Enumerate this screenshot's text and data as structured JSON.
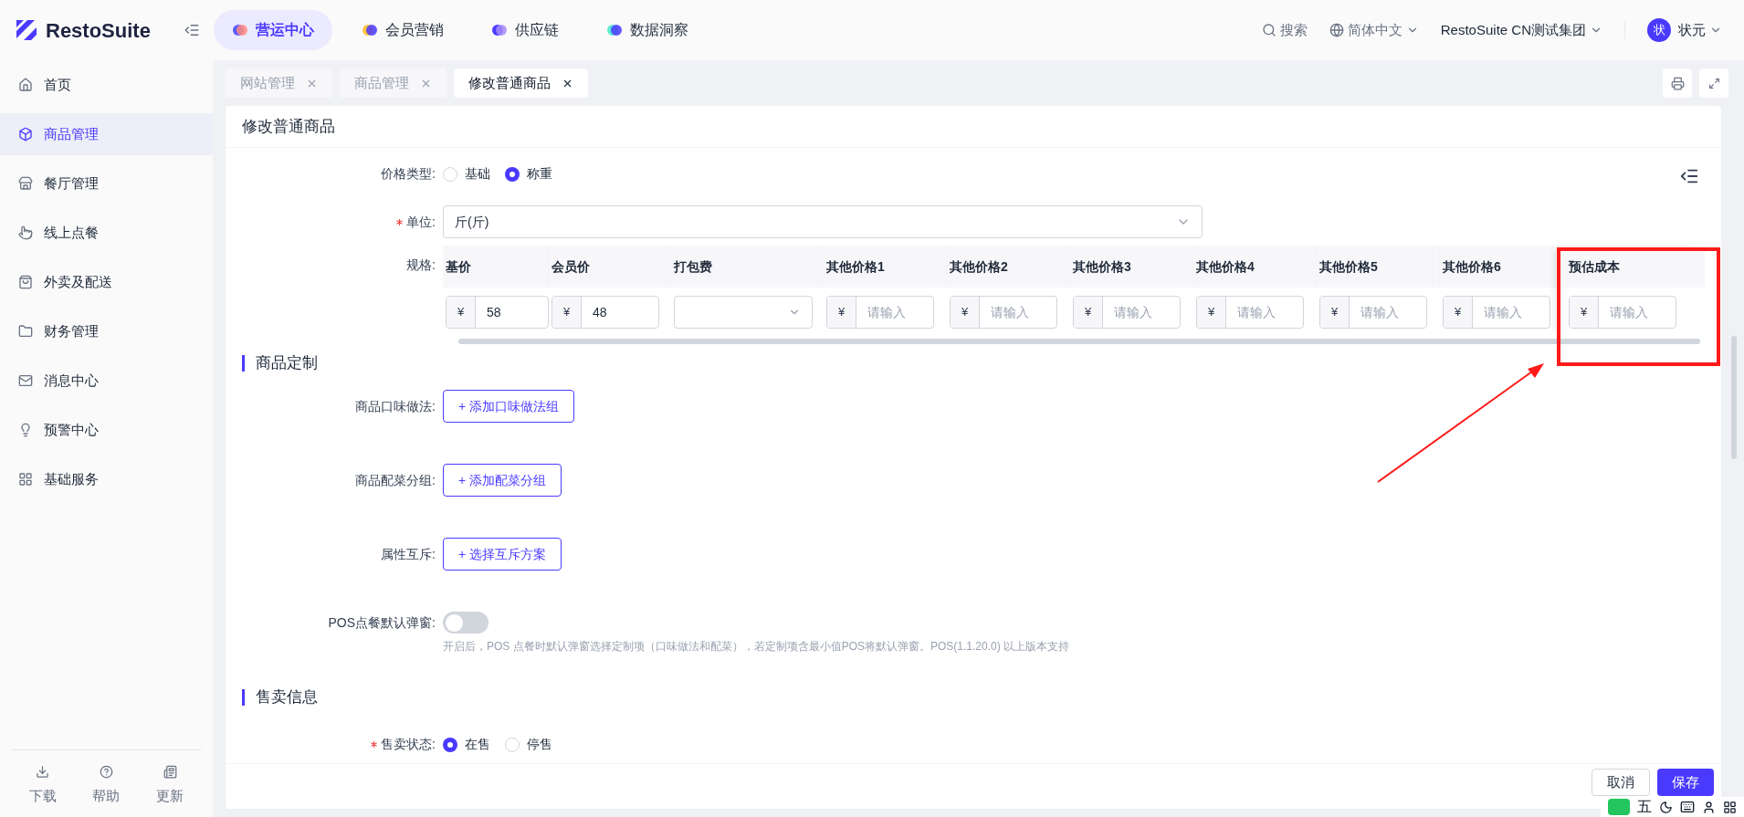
{
  "header": {
    "logo": "RestoSuite",
    "nav": [
      {
        "label": "营运中心",
        "selected": true
      },
      {
        "label": "会员营销",
        "selected": false
      },
      {
        "label": "供应链",
        "selected": false
      },
      {
        "label": "数据洞察",
        "selected": false
      }
    ],
    "search": "搜索",
    "language": "简体中文",
    "org": "RestoSuite CN测试集团",
    "user": {
      "avatar": "状",
      "name": "状元"
    }
  },
  "sidebar": {
    "items": [
      {
        "label": "首页",
        "selected": false
      },
      {
        "label": "商品管理",
        "selected": true
      },
      {
        "label": "餐厅管理",
        "selected": false
      },
      {
        "label": "线上点餐",
        "selected": false
      },
      {
        "label": "外卖及配送",
        "selected": false
      },
      {
        "label": "财务管理",
        "selected": false
      },
      {
        "label": "消息中心",
        "selected": false
      },
      {
        "label": "预警中心",
        "selected": false
      },
      {
        "label": "基础服务",
        "selected": false
      }
    ],
    "footer": [
      "下载",
      "帮助",
      "更新"
    ]
  },
  "tabs": [
    {
      "label": "网站管理",
      "selected": false
    },
    {
      "label": "商品管理",
      "selected": false
    },
    {
      "label": "修改普通商品",
      "selected": true
    }
  ],
  "page": {
    "title": "修改普通商品",
    "price_type": {
      "label": "价格类型:",
      "options": [
        {
          "label": "基础",
          "selected": false
        },
        {
          "label": "称重",
          "selected": true
        }
      ]
    },
    "unit": {
      "label": "单位:",
      "required": true,
      "value": "斤(斤)"
    },
    "spec": {
      "label": "规格:",
      "columns": [
        {
          "header": "基价",
          "kind": "price",
          "prefix": "¥",
          "value": "58"
        },
        {
          "header": "会员价",
          "kind": "price",
          "prefix": "¥",
          "value": "48"
        },
        {
          "header": "打包费",
          "kind": "select"
        },
        {
          "header": "其他价格1",
          "kind": "price",
          "prefix": "¥",
          "placeholder": "请输入"
        },
        {
          "header": "其他价格2",
          "kind": "price",
          "prefix": "¥",
          "placeholder": "请输入"
        },
        {
          "header": "其他价格3",
          "kind": "price",
          "prefix": "¥",
          "placeholder": "请输入"
        },
        {
          "header": "其他价格4",
          "kind": "price",
          "prefix": "¥",
          "placeholder": "请输入"
        },
        {
          "header": "其他价格5",
          "kind": "price",
          "prefix": "¥",
          "placeholder": "请输入"
        },
        {
          "header": "其他价格6",
          "kind": "price",
          "prefix": "¥",
          "placeholder": "请输入"
        }
      ],
      "fixed_column": {
        "header": "预估成本",
        "kind": "price",
        "prefix": "¥",
        "placeholder": "请输入"
      }
    },
    "customization": {
      "title": "商品定制",
      "rows": [
        {
          "label": "商品口味做法:",
          "button": "+ 添加口味做法组"
        },
        {
          "label": "商品配菜分组:",
          "button": "+ 添加配菜分组"
        },
        {
          "label": "属性互斥:",
          "button": "+ 选择互斥方案"
        }
      ],
      "toggle": {
        "label": "POS点餐默认弹窗:",
        "on": false,
        "hint": "开启后，POS 点餐时默认弹窗选择定制项（口味做法和配菜），若定制项含最小值POS将默认弹窗。POS(1.1.20.0) 以上版本支持"
      }
    },
    "sales": {
      "title": "售卖信息",
      "status": {
        "label": "售卖状态:",
        "required": true,
        "options": [
          {
            "label": "在售",
            "selected": true
          },
          {
            "label": "停售",
            "selected": false
          }
        ]
      }
    },
    "buttons": [
      {
        "label": "取消",
        "kind": "secondary"
      },
      {
        "label": "保存",
        "kind": "primary"
      }
    ]
  },
  "ime_bar": {
    "label": "五"
  }
}
